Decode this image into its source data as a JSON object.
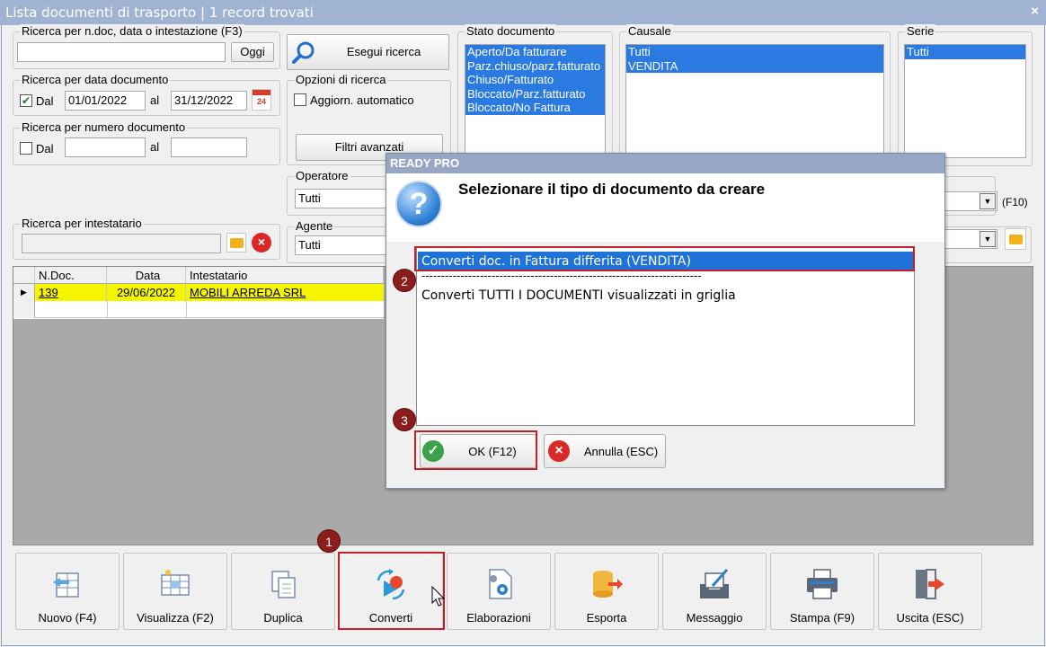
{
  "window": {
    "title": "Lista documenti di trasporto | 1 record trovati",
    "close_label": "×"
  },
  "search": {
    "general": {
      "label": "Ricerca per n.doc, data o intestazione (F3)",
      "value": "",
      "today_button": "Oggi"
    },
    "execute_button": "Esegui ricerca",
    "by_date": {
      "label": "Ricerca per data documento",
      "dal_checked": true,
      "dal_label": "Dal",
      "from": "01/01/2022",
      "al_label": "al",
      "to": "31/12/2022",
      "calendar_day": "24"
    },
    "by_number": {
      "label": "Ricerca per numero documento",
      "dal_checked": false,
      "dal_label": "Dal",
      "from": "",
      "al_label": "al",
      "to": ""
    },
    "options": {
      "label": "Opzioni di ricerca",
      "auto_refresh": "Aggiorn. automatico",
      "advanced_filters": "Filtri avanzati"
    },
    "operator": {
      "label": "Operatore",
      "value": "Tutti"
    },
    "holder": {
      "label": "Ricerca per intestatario",
      "value": ""
    },
    "agent": {
      "label": "Agente",
      "value": "Tutti"
    },
    "f10_label": "(F10)"
  },
  "filters": {
    "stato": {
      "label": "Stato documento",
      "items": [
        "Aperto/Da fatturare",
        "Parz.chiuso/parz.fatturato",
        "Chiuso/Fatturato",
        "Bloccato/Parz.fatturato",
        "Bloccato/No Fattura"
      ]
    },
    "causale": {
      "label": "Causale",
      "items": [
        "Tutti",
        "VENDITA"
      ]
    },
    "serie": {
      "label": "Serie",
      "items": [
        "Tutti"
      ]
    }
  },
  "grid": {
    "columns": [
      "N.Doc.",
      "Data",
      "Intestatario"
    ],
    "rows": [
      {
        "ndoc": "139",
        "data": "29/06/2022",
        "intestatario": "MOBILI ARREDA SRL"
      }
    ]
  },
  "toolbar": {
    "nuovo": "Nuovo (F4)",
    "visualizza": "Visualizza (F2)",
    "duplica": "Duplica",
    "converti": "Converti",
    "elaborazioni": "Elaborazioni",
    "esporta": "Esporta",
    "messaggio": "Messaggio",
    "stampa": "Stampa (F9)",
    "uscita": "Uscita (ESC)"
  },
  "dialog": {
    "title": "READY PRO",
    "heading": "Selezionare il tipo di documento da creare",
    "options": [
      "Converti doc. in Fattura differita (VENDITA)",
      "------------------------------------------------------------------------",
      "Converti TUTTI I DOCUMENTI visualizzati in griglia"
    ],
    "ok_button": "OK (F12)",
    "cancel_button": "Annulla (ESC)"
  },
  "annotations": {
    "step1": "1",
    "step2": "2",
    "step3": "3"
  },
  "colors": {
    "selection": "#2a7ae2",
    "highlight_row": "#f5f500",
    "annotation_red": "#c0202c",
    "badge": "#8b1d1d"
  }
}
